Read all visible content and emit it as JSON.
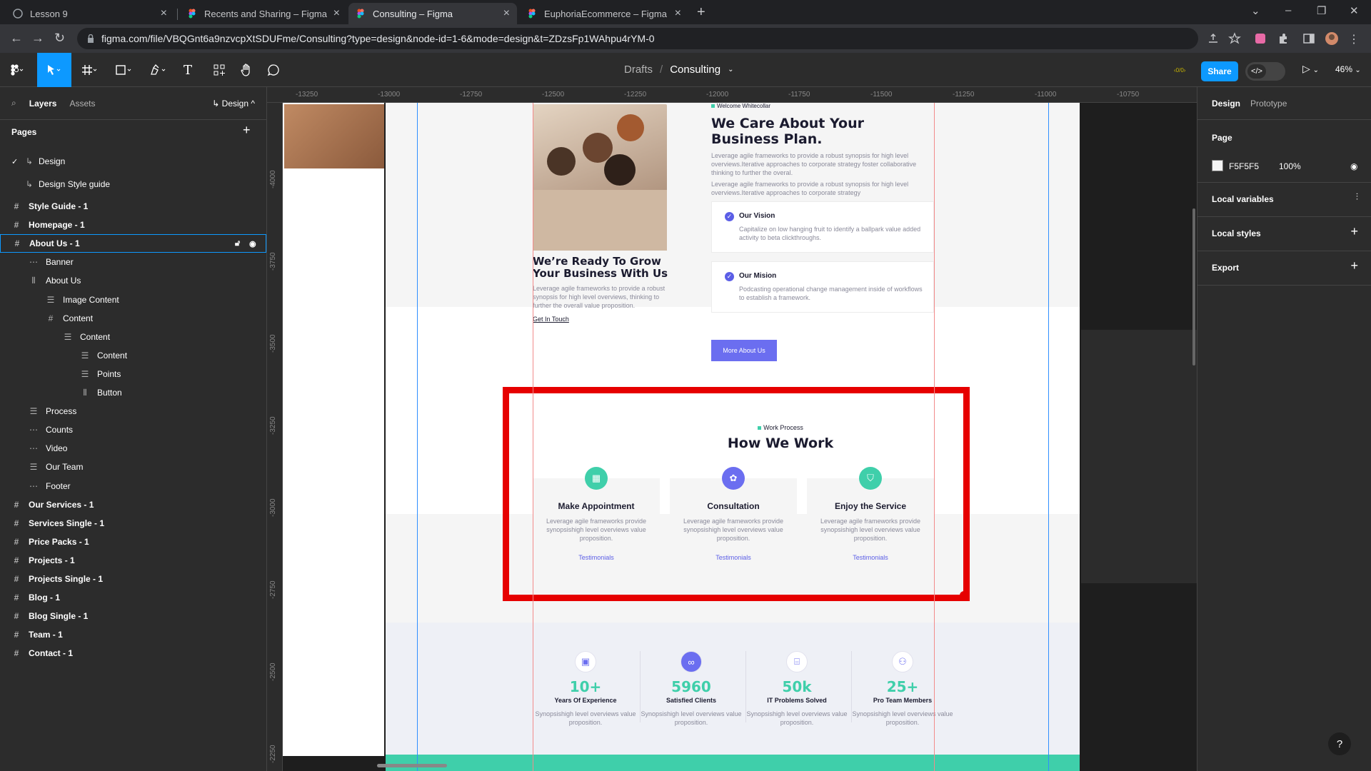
{
  "browser": {
    "tabs": [
      {
        "label": "Lesson 9"
      },
      {
        "label": "Recents and Sharing – Figma"
      },
      {
        "label": "Consulting – Figma"
      },
      {
        "label": "EuphoriaEcommerce – Figma"
      }
    ],
    "url": "figma.com/file/VBQGnt6a9nzvcpXtSDUFme/Consulting?type=design&node-id=1-6&mode=design&t=ZDzsFp1WAhpu4rYM-0"
  },
  "toolbar": {
    "breadcrumb_drafts": "Drafts",
    "breadcrumb_sep": "/",
    "breadcrumb_file": "Consulting",
    "share_label": "Share",
    "zoom": "46%",
    "dev_toggle_icon": "</>"
  },
  "left_panel": {
    "tab_layers": "Layers",
    "tab_assets": "Assets",
    "page_switch": "↳ Design ^",
    "pages_heading": "Pages",
    "pages": [
      {
        "label": "Design",
        "selected": true
      },
      {
        "label": "Design Style guide",
        "selected": false
      }
    ],
    "layers": [
      {
        "label": "Style Guide - 1",
        "icon": "frame-icon",
        "bold": true
      },
      {
        "label": "Homepage - 1",
        "icon": "frame-icon",
        "bold": true
      },
      {
        "label": "About Us - 1",
        "icon": "frame-icon",
        "bold": true,
        "selected": true
      },
      {
        "label": "Banner",
        "icon": "section-icon"
      },
      {
        "label": "About Us",
        "icon": "column-icon"
      },
      {
        "label": "Image Content",
        "icon": "stack-icon"
      },
      {
        "label": "Content",
        "icon": "frame-icon"
      },
      {
        "label": "Content",
        "icon": "stack-icon"
      },
      {
        "label": "Content",
        "icon": "stack-icon"
      },
      {
        "label": "Points",
        "icon": "stack-icon"
      },
      {
        "label": "Button",
        "icon": "column-icon"
      },
      {
        "label": "Process",
        "icon": "stack-icon"
      },
      {
        "label": "Counts",
        "icon": "section-icon"
      },
      {
        "label": "Video",
        "icon": "section-icon"
      },
      {
        "label": "Our Team",
        "icon": "stack-icon"
      },
      {
        "label": "Footer",
        "icon": "section-icon"
      },
      {
        "label": "Our Services - 1",
        "icon": "frame-icon",
        "bold": true
      },
      {
        "label": "Services Single - 1",
        "icon": "frame-icon",
        "bold": true
      },
      {
        "label": "Price Packs - 1",
        "icon": "frame-icon",
        "bold": true
      },
      {
        "label": "Projects - 1",
        "icon": "frame-icon",
        "bold": true
      },
      {
        "label": "Projects Single - 1",
        "icon": "frame-icon",
        "bold": true
      },
      {
        "label": "Blog - 1",
        "icon": "frame-icon",
        "bold": true
      },
      {
        "label": "Blog Single - 1",
        "icon": "frame-icon",
        "bold": true
      },
      {
        "label": "Team - 1",
        "icon": "frame-icon",
        "bold": true
      },
      {
        "label": "Contact - 1",
        "icon": "frame-icon",
        "bold": true
      }
    ]
  },
  "rulers": {
    "top": [
      "-13250",
      "-13000",
      "-12750",
      "-12500",
      "-12250",
      "-12000",
      "-11750",
      "-11500",
      "-11250",
      "-11000",
      "-10750"
    ],
    "left": [
      "-4000",
      "-3750",
      "-3500",
      "-3250",
      "-3000",
      "-2750",
      "-2500",
      "-2250"
    ]
  },
  "design": {
    "ready_title": "We’re Ready To Grow Your Business With Us",
    "ready_body": "Leverage agile frameworks to provide a robust synopsis for high level overviews, thinking to further the overall value proposition.",
    "ready_link": "Get In Touch",
    "welcome_tag": "Welcome Whitecollar",
    "care_title": "We Care About Your Business Plan.",
    "care_p1": "Leverage agile frameworks to provide a robust synopsis for high level overviews.Iterative approaches to corporate strategy foster collaborative thinking to further the overal.",
    "care_p2": "Leverage agile frameworks to provide a robust synopsis for high level overviews.Iterative approaches to corporate strategy",
    "vision_title": "Our Vision",
    "vision_body": "Capitalize on low hanging fruit to identify a ballpark value added activity to beta clickthroughs.",
    "mission_title": "Our Mision",
    "mission_body": "Podcasting operational change management inside of workflows to establish a framework.",
    "more_button": "More About Us",
    "process_tag": "Work Process",
    "process_title": "How We Work",
    "process_cards": [
      {
        "title": "Make Appointment",
        "body": "Leverage agile frameworks provide synopsishigh level overviews value proposition.",
        "link": "Testimonials",
        "icon": "calendar-icon",
        "color": "#3fcfaa"
      },
      {
        "title": "Consultation",
        "body": "Leverage agile frameworks provide synopsishigh level overviews value proposition.",
        "link": "Testimonials",
        "icon": "puzzle-icon",
        "color": "#6b6ef0"
      },
      {
        "title": "Enjoy the Service",
        "body": "Leverage agile frameworks provide synopsishigh level overviews value proposition.",
        "link": "Testimonials",
        "icon": "shield-check-icon",
        "color": "#3fcfaa"
      }
    ],
    "counts": [
      {
        "value": "10+",
        "label": "Years Of Experience",
        "desc": "Synopsishigh level overviews value proposition.",
        "icon": "briefcase-icon"
      },
      {
        "value": "5960",
        "label": "Satisfied Clients",
        "desc": "Synopsishigh level overviews value proposition.",
        "icon": "handshake-icon"
      },
      {
        "value": "50k",
        "label": "IT Problems Solved",
        "desc": "Synopsishigh level overviews value proposition.",
        "icon": "code-file-icon"
      },
      {
        "value": "25+",
        "label": "Pro Team Members",
        "desc": "Synopsishigh level overviews value proposition.",
        "icon": "team-icon"
      }
    ]
  },
  "right_panel": {
    "tab_design": "Design",
    "tab_prototype": "Prototype",
    "page_heading": "Page",
    "page_color": "F5F5F5",
    "page_opacity": "100%",
    "local_variables": "Local variables",
    "local_styles": "Local styles",
    "export": "Export",
    "help": "?"
  },
  "colors": {
    "accent_blue": "#0d99ff",
    "highlight_red": "#e60000",
    "brand_purple": "#6b6ef0",
    "brand_teal": "#3fcfaa"
  }
}
